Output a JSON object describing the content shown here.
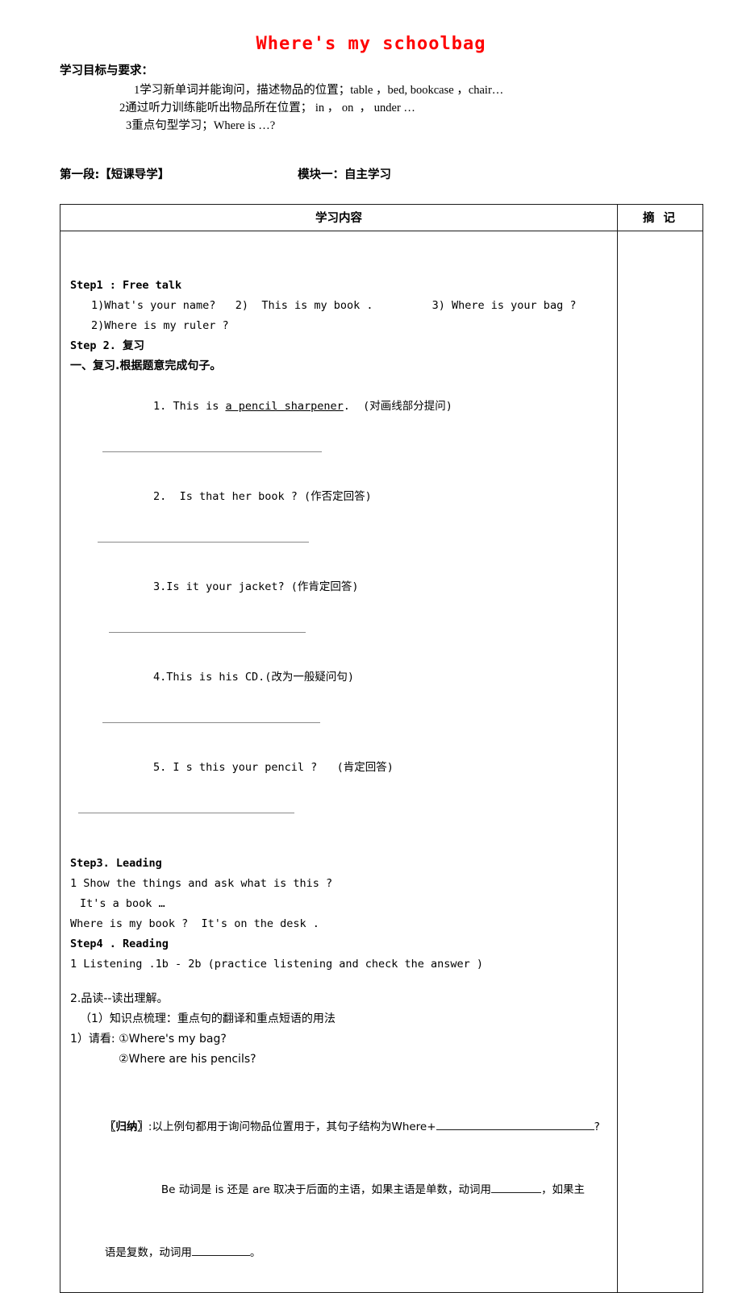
{
  "document": {
    "title": "Where's my schoolbag",
    "title_color": "#ff0000",
    "objectives": {
      "heading": "学习目标与要求：",
      "items": [
        "1学习新单词并能询问，描述物品的位置；table ，bed, bookcase ，chair…",
        "2通过听力训练能听出物品所在位置； in ， on  ， under …",
        "3重点句型学习；Where is …?"
      ]
    },
    "segment": {
      "left_label": "第一段:【短课导学】",
      "right_label": "模块一：自主学习"
    },
    "table": {
      "header_content": "学习内容",
      "header_notes": "摘 记"
    },
    "content": {
      "step1": {
        "heading": "Step1 : Free talk",
        "line1": "1)What's your name?   2)  This is my book .         3) Where is your bag ?",
        "line2": "2)Where is my ruler ?"
      },
      "step2": {
        "heading": "Step 2. 复习",
        "subheading": "一、复习.根据题意完成句子。",
        "exercises": [
          {
            "number": "1.",
            "prefix": "This is ",
            "underlined": "a pencil sharpener",
            "suffix": ".  (对画线部分提问)"
          },
          {
            "number": "2.",
            "prefix": "Is that her book ? (作否定回答)",
            "underlined": "",
            "suffix": ""
          },
          {
            "number": "3.",
            "prefix": "Is it your jacket? (作肯定回答)",
            "underlined": "",
            "suffix": ""
          },
          {
            "number": "4.",
            "prefix": "This is his CD.(改为一般疑问句)",
            "underlined": "",
            "suffix": ""
          },
          {
            "number": "5.",
            "prefix": " I s this your pencil ?   (肯定回答)",
            "underlined": "",
            "suffix": ""
          }
        ]
      },
      "step3": {
        "heading": "Step3. Leading",
        "line1": "1 Show the things and ask what is this ?",
        "line2": "It's a book …",
        "line3": "Where is my book ?  It's on the desk ."
      },
      "step4": {
        "heading": "Step4 . Reading",
        "line1": "1 Listening .1b - 2b (practice listening and check the answer )",
        "line2": "2.品读--读出理解。",
        "line3": "（1）知识点梳理：重点句的翻译和重点短语的用法",
        "line4": "1）请看: ①Where's my bag?",
        "line5": "②Where are his pencils?"
      },
      "summary": {
        "tag": "〖归纳〗",
        "line1_a": ":以上例句都用于询问物品位置用于，其句子结构为Where+",
        "line1_b": "?",
        "line2_a": "Be 动词是 is 还是 are 取决于后面的主语，如果主语是单数，动词用",
        "line2_b": "，如果主",
        "line3_a": "语是复数，动词用",
        "line3_b": "。"
      }
    }
  }
}
